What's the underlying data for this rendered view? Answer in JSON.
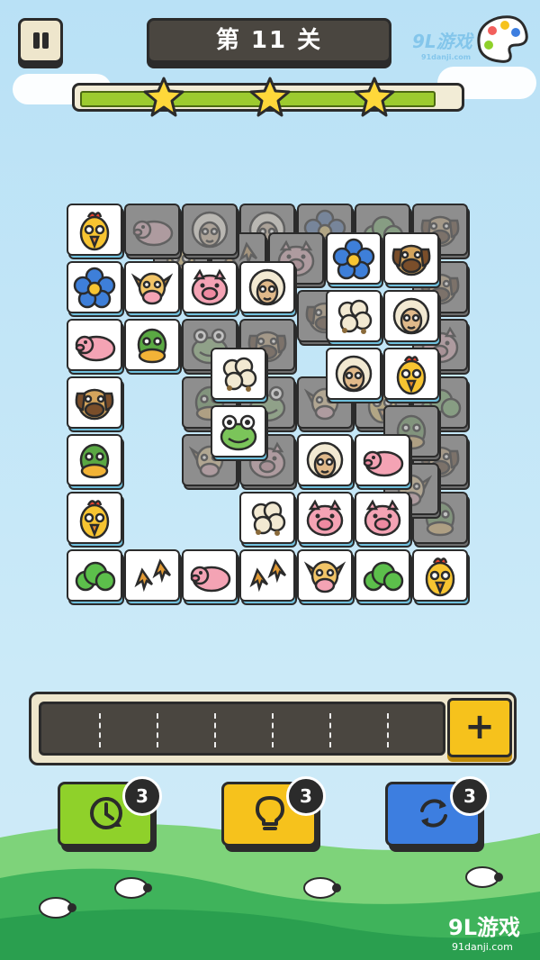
{
  "header": {
    "level_title": "第 11 关",
    "pause_icon": "pause-icon",
    "skin_icon": "palette-icon"
  },
  "progress": {
    "fraction": 0.93,
    "stars_earned": 3
  },
  "board": {
    "tiles": [
      {
        "kind": "chicken",
        "col": 0,
        "row": 0,
        "dim": false
      },
      {
        "kind": "flower",
        "col": 0,
        "row": 1,
        "dim": false
      },
      {
        "kind": "pig2",
        "col": 0,
        "row": 2,
        "dim": false
      },
      {
        "kind": "dog",
        "col": 0,
        "row": 3,
        "dim": false
      },
      {
        "kind": "duck",
        "col": 0,
        "row": 4,
        "dim": false
      },
      {
        "kind": "chicken",
        "col": 0,
        "row": 5,
        "dim": false
      },
      {
        "kind": "bush",
        "col": 0,
        "row": 6,
        "dim": false
      },
      {
        "kind": "pig2",
        "col": 1,
        "row": 0,
        "dim": true
      },
      {
        "kind": "cow",
        "col": 1,
        "row": 1,
        "dim": false
      },
      {
        "kind": "duck",
        "col": 1,
        "row": 2,
        "dim": false
      },
      {
        "kind": "feet",
        "col": 1,
        "row": 6,
        "dim": false
      },
      {
        "kind": "sheep",
        "col": 2,
        "row": 0,
        "dim": true
      },
      {
        "kind": "pig",
        "col": 2,
        "row": 1,
        "dim": false
      },
      {
        "kind": "frog",
        "col": 2,
        "row": 2,
        "dim": true
      },
      {
        "kind": "pig2",
        "col": 2,
        "row": 6,
        "dim": false
      },
      {
        "kind": "cotton",
        "col": 2.5,
        "row": 2.5,
        "dim": false
      },
      {
        "kind": "frog",
        "col": 2.5,
        "row": 3.5,
        "dim": false
      },
      {
        "kind": "sheep",
        "col": 3,
        "row": 1,
        "dim": false
      },
      {
        "kind": "cotton",
        "col": 3,
        "row": 5,
        "dim": false
      },
      {
        "kind": "feet",
        "col": 3,
        "row": 6,
        "dim": false
      },
      {
        "kind": "dog",
        "col": 4.5,
        "row": 2.5,
        "dim": true
      },
      {
        "kind": "sheep",
        "col": 4,
        "row": 4,
        "dim": false
      },
      {
        "kind": "pig",
        "col": 4,
        "row": 5,
        "dim": false
      },
      {
        "kind": "cow",
        "col": 4,
        "row": 6,
        "dim": false
      },
      {
        "kind": "flower",
        "col": 4.5,
        "row": 0.5,
        "dim": false
      },
      {
        "kind": "cotton",
        "col": 4.5,
        "row": 1.5,
        "dim": false
      },
      {
        "kind": "sheep",
        "col": 4.5,
        "row": 2.5,
        "dim": false
      },
      {
        "kind": "duck",
        "col": 5.5,
        "row": 3.5,
        "dim": true
      },
      {
        "kind": "pig2",
        "col": 5,
        "row": 4,
        "dim": false
      },
      {
        "kind": "pig",
        "col": 5,
        "row": 5,
        "dim": false
      },
      {
        "kind": "bush",
        "col": 5,
        "row": 6,
        "dim": false
      },
      {
        "kind": "dog",
        "col": 5.5,
        "row": 0.5,
        "dim": false
      },
      {
        "kind": "sheep",
        "col": 5.5,
        "row": 1.5,
        "dim": false
      },
      {
        "kind": "chicken",
        "col": 5.5,
        "row": 2.5,
        "dim": false
      },
      {
        "kind": "chicken",
        "col": 6,
        "row": 6,
        "dim": false
      }
    ],
    "under_tiles": [
      {
        "kind": "sheep",
        "col": 3,
        "row": 0
      },
      {
        "kind": "flower",
        "col": 4,
        "row": 0
      },
      {
        "kind": "bush",
        "col": 5,
        "row": 0
      },
      {
        "kind": "dog",
        "col": 6,
        "row": 0
      },
      {
        "kind": "chicken",
        "col": 1.5,
        "row": 0.5
      },
      {
        "kind": "feet",
        "col": 2.5,
        "row": 0.5
      },
      {
        "kind": "pig",
        "col": 3.5,
        "row": 0.5
      },
      {
        "kind": "dog",
        "col": 6,
        "row": 1
      },
      {
        "kind": "dog",
        "col": 4,
        "row": 1.5
      },
      {
        "kind": "dog",
        "col": 3,
        "row": 2
      },
      {
        "kind": "cow",
        "col": 4,
        "row": 3
      },
      {
        "kind": "duck",
        "col": 2,
        "row": 3
      },
      {
        "kind": "frog",
        "col": 3,
        "row": 3
      },
      {
        "kind": "pig",
        "col": 6,
        "row": 2
      },
      {
        "kind": "bush",
        "col": 6,
        "row": 3
      },
      {
        "kind": "dog",
        "col": 6,
        "row": 4
      },
      {
        "kind": "duck",
        "col": 6,
        "row": 5
      },
      {
        "kind": "chicken",
        "col": 5,
        "row": 3
      },
      {
        "kind": "cow",
        "col": 2,
        "row": 4
      },
      {
        "kind": "pig",
        "col": 3,
        "row": 4
      },
      {
        "kind": "cow",
        "col": 5.5,
        "row": 4.5
      }
    ]
  },
  "tray": {
    "slots": 7,
    "add_label": "+"
  },
  "powerups": [
    {
      "name": "undo",
      "icon": "clock-undo-icon",
      "count": "3",
      "color": "#8fd12a"
    },
    {
      "name": "hint",
      "icon": "lightbulb-icon",
      "count": "3",
      "color": "#f6c21c"
    },
    {
      "name": "shuffle",
      "icon": "refresh-icon",
      "count": "3",
      "color": "#3d7ee0"
    }
  ],
  "watermarks": {
    "top": "9L游戏",
    "top_url": "91danji.com",
    "bottom": "9L游戏",
    "bottom_url": "91danji.com"
  }
}
